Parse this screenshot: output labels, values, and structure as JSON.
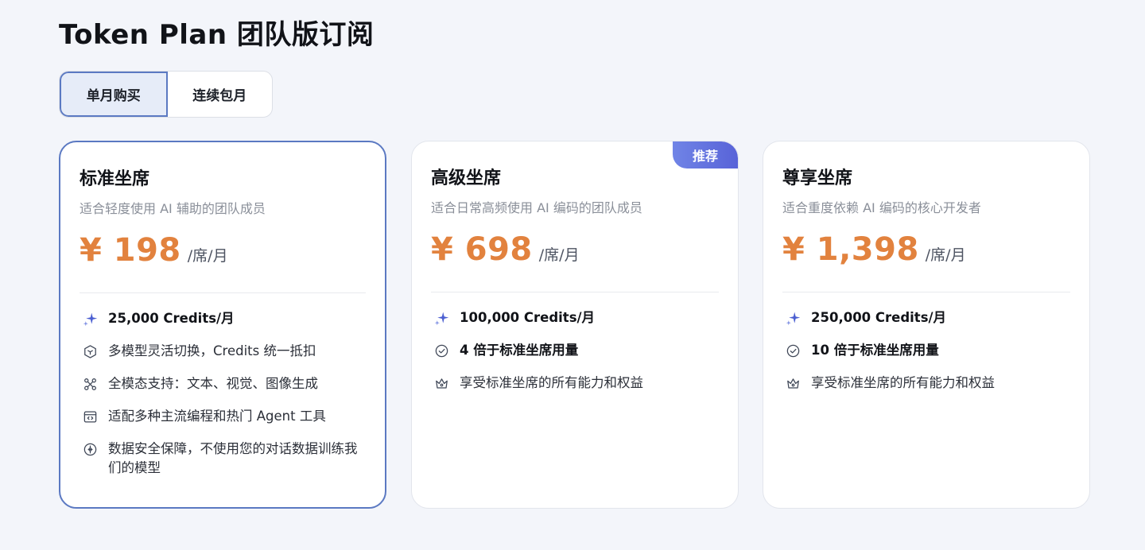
{
  "page": {
    "title": "Token Plan 团队版订阅"
  },
  "billing_tabs": [
    {
      "label": "单月购买",
      "active": true
    },
    {
      "label": "连续包月",
      "active": false
    }
  ],
  "plans": [
    {
      "name": "标准坐席",
      "description": "适合轻度使用 AI 辅助的团队成员",
      "price": "¥ 198",
      "unit": "/席/月",
      "features": [
        {
          "icon": "sparkle-icon",
          "text": "25,000 Credits/月"
        },
        {
          "icon": "cube-icon",
          "text": "多模型灵活切换，Credits 统一抵扣"
        },
        {
          "icon": "multimodal-icon",
          "text": "全模态支持：文本、视觉、图像生成"
        },
        {
          "icon": "code-window-icon",
          "text": "适配多种主流编程和热门 Agent 工具"
        },
        {
          "icon": "shield-icon",
          "text": "数据安全保障，不使用您的对话数据训练我们的模型"
        }
      ]
    },
    {
      "name": "高级坐席",
      "badge": "推荐",
      "description": "适合日常高频使用 AI 编码的团队成员",
      "price": "¥ 698",
      "unit": "/席/月",
      "features": [
        {
          "icon": "sparkle-icon",
          "text": "100,000 Credits/月"
        },
        {
          "icon": "check-circle-icon",
          "text": "4 倍于标准坐席用量"
        },
        {
          "icon": "crown-icon",
          "text": "享受标准坐席的所有能力和权益"
        }
      ]
    },
    {
      "name": "尊享坐席",
      "description": "适合重度依赖 AI 编码的核心开发者",
      "price": "¥ 1,398",
      "unit": "/席/月",
      "features": [
        {
          "icon": "sparkle-icon",
          "text": "250,000 Credits/月"
        },
        {
          "icon": "check-circle-icon",
          "text": "10 倍于标准坐席用量"
        },
        {
          "icon": "crown-icon",
          "text": "享受标准坐席的所有能力和权益"
        }
      ]
    }
  ],
  "colors": {
    "accent": "#5b79c2",
    "price": "#e2823e",
    "badge": "#5f6edb",
    "sparkle": "#4b5fd1"
  }
}
